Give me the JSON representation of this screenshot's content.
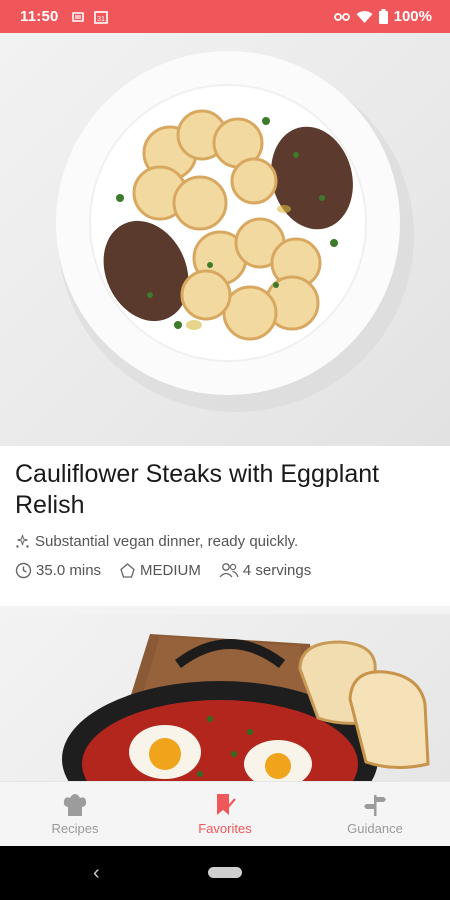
{
  "status_bar": {
    "time": "11:50",
    "battery": "100%"
  },
  "recipe1": {
    "title": "Cauliflower Steaks with Eggplant Relish",
    "description": "Substantial vegan dinner, ready quickly.",
    "time": "35.0 mins",
    "difficulty": "MEDIUM",
    "servings": "4 servings"
  },
  "bottom_nav": {
    "recipes": "Recipes",
    "favorites": "Favorites",
    "guidance": "Guidance",
    "active": "favorites"
  },
  "colors": {
    "accent": "#f0575b"
  },
  "icons": [
    "calendar-icon",
    "wifi-icon",
    "battery-icon",
    "sparkle-icon",
    "clock-icon",
    "difficulty-icon",
    "people-icon",
    "chef-hat-icon",
    "bookmark-icon",
    "signpost-icon"
  ]
}
